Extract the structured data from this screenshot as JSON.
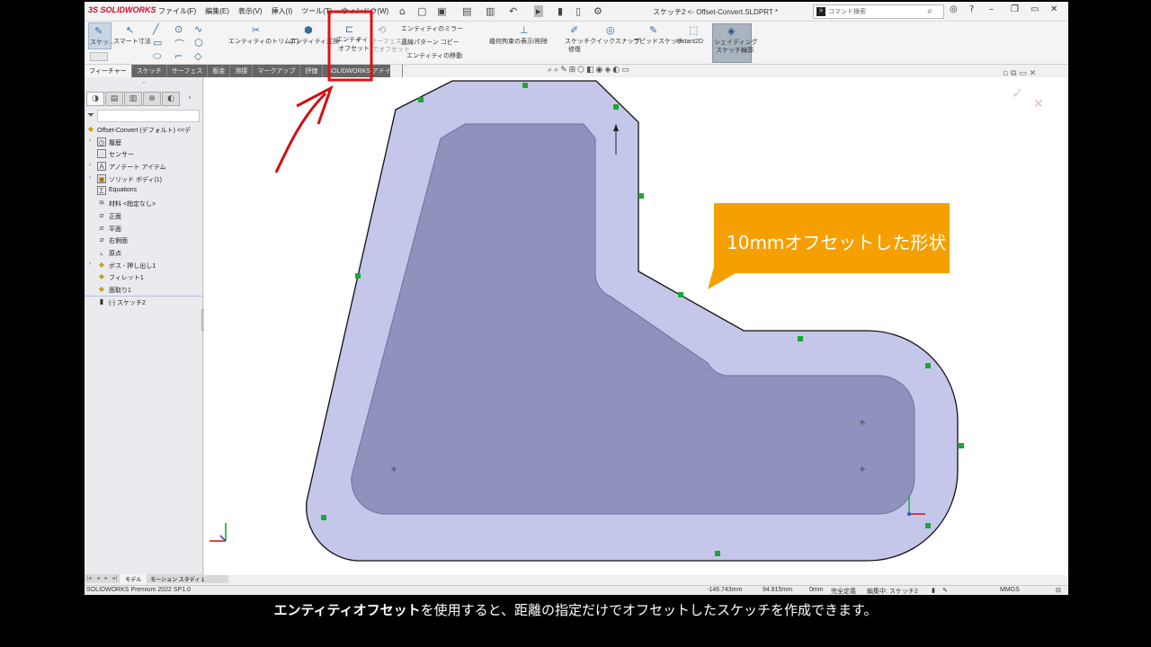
{
  "app": {
    "logo": "3S SOLIDWORKS",
    "menus": [
      "ファイル(F)",
      "編集(E)",
      "表示(V)",
      "挿入(I)",
      "ツール(T)",
      "ウィンドウ(W)"
    ],
    "doc_title": "スケッチ2 <- Offset-Convert.SLDPRT *",
    "search_placeholder": "コマンド検索"
  },
  "command_manager": {
    "sketch_label": "スケッ...",
    "smart_dim_label": "スマート寸法",
    "trim_label": "エンティティのトリム(T)",
    "convert_label": "エンティティ変換",
    "offset_label_1": "エンティ",
    "offset_label_2": "ティ",
    "offset_label_3": "オフセット",
    "surface_offset_1": "サーフェス上",
    "surface_offset_2": "でオフセット",
    "mirror_label": "エンティティのミラー",
    "linear_pattern_label": "直線パターン コピー",
    "move_label": "エンティティの移動",
    "relations_label": "幾何拘束の表示/削除",
    "repair_label_1": "スケッチ",
    "repair_label_2": "修復",
    "quick_snaps_label": "クイックスナップ",
    "rapid_sketch_label": "ラピッドスケッチ",
    "instant2d_label": "Instant2D",
    "shaded_label_1": "シェイディング",
    "shaded_label_2": "スケッチ輪郭"
  },
  "tabs": [
    "フィーチャー",
    "スケッチ",
    "サーフェス",
    "板金",
    "溶接",
    "マークアップ",
    "評価",
    "SOLIDWORKS アドイン"
  ],
  "tree": {
    "root": "Offset-Convert (デフォルト) <<デ",
    "items": [
      {
        "label": "履歴",
        "icon": "history-icon",
        "expand": true
      },
      {
        "label": "センサー",
        "icon": "sensor-icon",
        "expand": false
      },
      {
        "label": "アノテート アイテム",
        "icon": "annotation-icon",
        "expand": true
      },
      {
        "label": "ソリッド ボディ(1)",
        "icon": "solid-body-icon",
        "expand": true
      },
      {
        "label": "Equations",
        "icon": "equations-icon",
        "expand": false
      },
      {
        "label": "材料 <指定なし>",
        "icon": "material-icon",
        "expand": false
      },
      {
        "label": "正面",
        "icon": "plane-icon",
        "expand": false
      },
      {
        "label": "平面",
        "icon": "plane-icon",
        "expand": false
      },
      {
        "label": "右側面",
        "icon": "plane-icon",
        "expand": false
      },
      {
        "label": "原点",
        "icon": "origin-icon",
        "expand": false
      },
      {
        "label": "ボス - 押し出し1",
        "icon": "extrude-icon",
        "expand": true
      },
      {
        "label": "フィレット1",
        "icon": "fillet-icon",
        "expand": false
      },
      {
        "label": "面取り1",
        "icon": "chamfer-icon",
        "expand": false
      },
      {
        "label": "(-) スケッチ2",
        "icon": "sketch-icon",
        "expand": false
      }
    ]
  },
  "bottom_tabs": [
    "モデル",
    "モーション スタディ 1"
  ],
  "status": {
    "app_version": "SOLIDWORKS Premium 2022 SP1.0",
    "x": "-146.743mm",
    "y": "94.815mm",
    "z": "0mm",
    "state": "完全定義",
    "editing": "編集中: スケッチ2",
    "units": "MMGS"
  },
  "callout_text": "10mmオフセットした形状",
  "caption": {
    "bold": "エンティティオフセット",
    "rest": "を使用すると、距離の指定だけでオフセットしたスケッチを作成できます。"
  },
  "colors": {
    "outer_fill": "#c4c6ea",
    "inner_fill": "#8f92bd",
    "callout": "#f5a000",
    "highlight_box": "#e0101a",
    "annotation_arrow": "#d01010"
  }
}
